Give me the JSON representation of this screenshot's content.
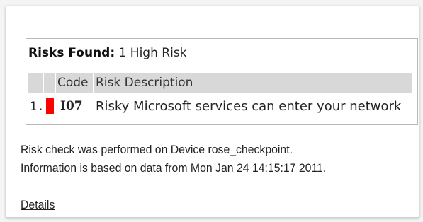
{
  "risks": {
    "label": "Risks Found",
    "colon": ":",
    "summary": "1 High Risk",
    "columns": [
      "",
      "",
      "Code",
      "Risk Description"
    ],
    "rows": [
      {
        "index": "1.",
        "severity_color": "#ff0000",
        "code": "I07",
        "description": "Risky Microsoft services can enter your network"
      }
    ]
  },
  "info": {
    "line1": "Risk check was performed on Device rose_checkpoint.",
    "line2": "Information is based on data from Mon Jan 24 14:15:17 2011."
  },
  "details_link": "Details"
}
